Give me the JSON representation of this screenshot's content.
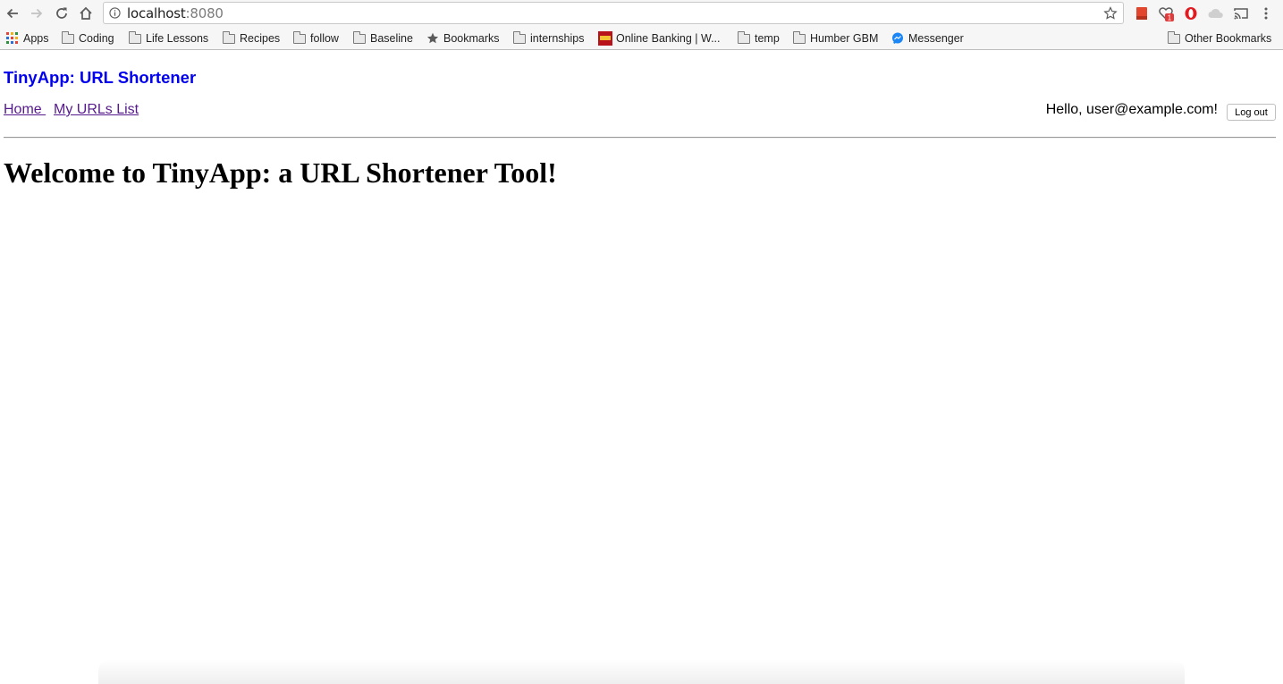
{
  "browser": {
    "url_host": "localhost",
    "url_port": ":8080",
    "extension_badge": "1"
  },
  "bookmarks": [
    {
      "label": "Apps",
      "icon": "apps-grid-icon"
    },
    {
      "label": "Coding",
      "icon": "folder-icon"
    },
    {
      "label": "Life Lessons",
      "icon": "folder-icon"
    },
    {
      "label": "Recipes",
      "icon": "folder-icon"
    },
    {
      "label": "follow",
      "icon": "folder-icon"
    },
    {
      "label": "Baseline",
      "icon": "folder-icon"
    },
    {
      "label": "Bookmarks",
      "icon": "star-icon"
    },
    {
      "label": "internships",
      "icon": "folder-icon"
    },
    {
      "label": "Online Banking | W...",
      "icon": "bank-favicon"
    },
    {
      "label": "temp",
      "icon": "folder-icon"
    },
    {
      "label": "Humber GBM",
      "icon": "folder-icon"
    },
    {
      "label": "Messenger",
      "icon": "messenger-icon"
    },
    {
      "label": "Other Bookmarks",
      "icon": "folder-icon"
    }
  ],
  "page": {
    "brand": "TinyApp: URL Shortener",
    "nav": {
      "home": "Home ",
      "my_urls": "My URLs List"
    },
    "greeting": "Hello, user@example.com!",
    "logout_label": "Log out",
    "heading": "Welcome to TinyApp: a URL Shortener Tool!"
  },
  "colors": {
    "brand_link": "#0000ee",
    "visited_link": "#551a8b"
  }
}
